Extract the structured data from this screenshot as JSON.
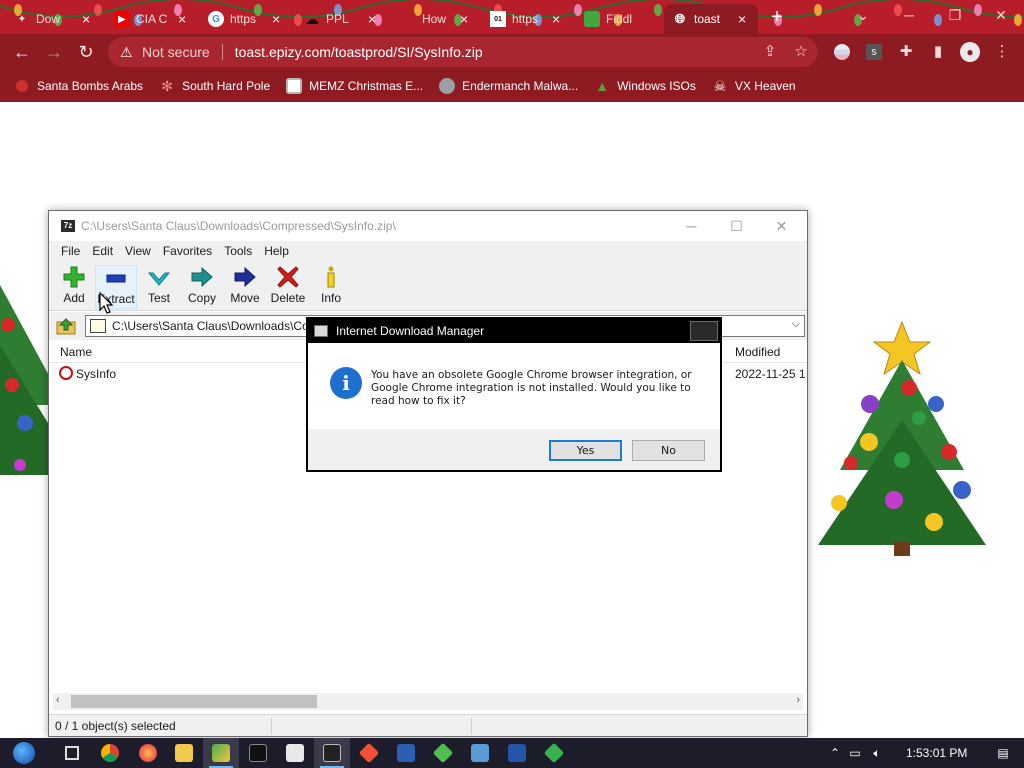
{
  "browser": {
    "tabs": [
      {
        "title": "Dow",
        "favicon": "santa-icon",
        "active": false
      },
      {
        "title": "CIA C",
        "favicon": "youtube-icon",
        "active": false
      },
      {
        "title": "https",
        "favicon": "google-icon",
        "active": false
      },
      {
        "title": "PPL",
        "favicon": "cloud-download-icon",
        "active": false
      },
      {
        "title": "How",
        "favicon": "light-icon",
        "active": false
      },
      {
        "title": "https",
        "favicon": "binary-icon",
        "active": false
      },
      {
        "title": "Fiddl",
        "favicon": "fiddle-icon",
        "active": false
      },
      {
        "title": "toast",
        "favicon": "globe-icon",
        "active": true
      }
    ],
    "address": {
      "security_label": "Not secure",
      "url": "toast.epizy.com/toastprod/SI/SysInfo.zip"
    },
    "bookmarks": [
      {
        "label": "Santa Bombs Arabs",
        "icon": "bomb-icon"
      },
      {
        "label": "South Hard Pole",
        "icon": "snowflake-icon"
      },
      {
        "label": "MEMZ Christmas E...",
        "icon": "window-icon"
      },
      {
        "label": "Endermanch Malwa...",
        "icon": "raccoon-icon"
      },
      {
        "label": "Windows ISOs",
        "icon": "tree-icon"
      },
      {
        "label": "VX Heaven",
        "icon": "skull-icon"
      }
    ]
  },
  "zip_window": {
    "title": "C:\\Users\\Santa Claus\\Downloads\\Compressed\\SysInfo.zip\\",
    "menu": [
      "File",
      "Edit",
      "View",
      "Favorites",
      "Tools",
      "Help"
    ],
    "tools": [
      {
        "label": "Add",
        "icon": "plus-icon",
        "color": "#2fb52f"
      },
      {
        "label": "Extract",
        "icon": "minus-icon",
        "color": "#1f3fb8"
      },
      {
        "label": "Test",
        "icon": "check-icon",
        "color": "#22b8c6"
      },
      {
        "label": "Copy",
        "icon": "double-arrow-icon",
        "color": "#1f8f8f"
      },
      {
        "label": "Move",
        "icon": "arrow-right-icon",
        "color": "#1f2f9a"
      },
      {
        "label": "Delete",
        "icon": "x-icon",
        "color": "#d41c1c"
      },
      {
        "label": "Info",
        "icon": "info-icon",
        "color": "#c9a800"
      }
    ],
    "path": "C:\\Users\\Santa Claus\\Downloads\\Compressed\\SysInfo.zip\\",
    "columns": {
      "name": "Name",
      "modified": "Modified"
    },
    "rows": [
      {
        "name": "SysInfo",
        "modified": "2022-11-25 1"
      }
    ],
    "status": "0 / 1 object(s) selected"
  },
  "dialog": {
    "title": "Internet Download Manager",
    "message": "You have an obsolete Google Chrome browser integration, or Google Chrome integration is not installed. Would you like to read how to fix it?",
    "yes_label": "Yes",
    "no_label": "No"
  },
  "taskbar": {
    "clock": "1:53:01 PM",
    "apps": [
      "start-icon",
      "task-view-icon",
      "chrome-icon",
      "firefox-icon",
      "explorer-icon",
      "paint-icon",
      "cmd-icon",
      "package-icon",
      "7zip-icon",
      "git-icon",
      "powershell-icon",
      "notepad-plus-icon",
      "control-panel-icon",
      "powershell-ise-icon",
      "sourcetree-icon"
    ]
  },
  "colors": {
    "chrome_frame": "#8e1a22",
    "tab_strip": "#b81e2a",
    "dialog_primary": "#1d7ad8"
  }
}
